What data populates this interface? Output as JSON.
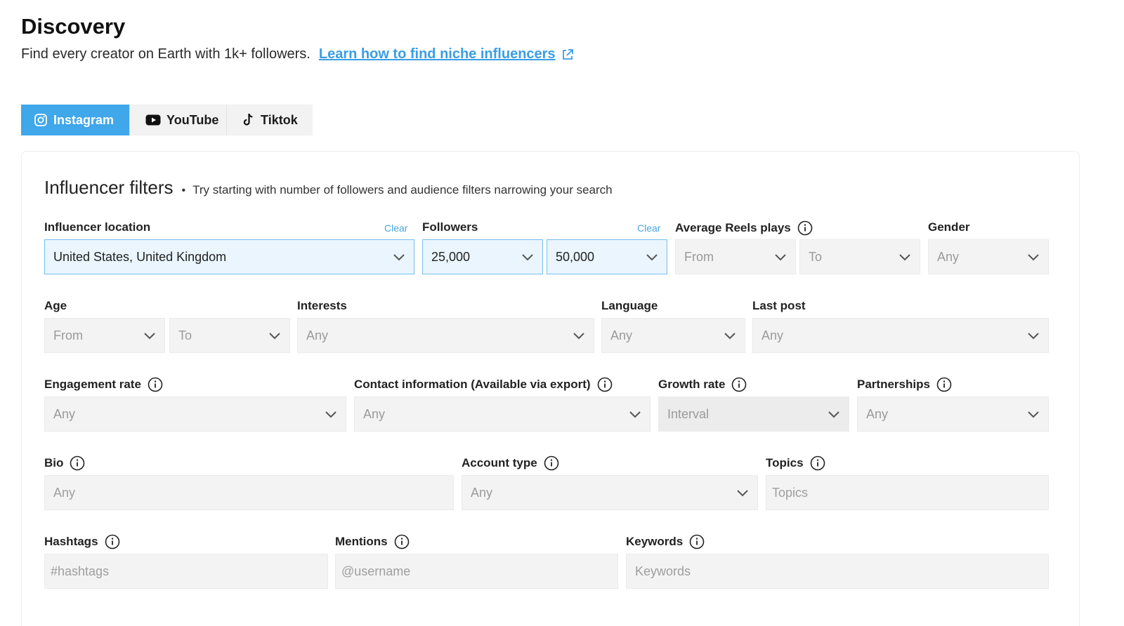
{
  "header": {
    "title": "Discovery",
    "subtitle": "Find every creator on Earth with 1k+ followers.",
    "link_label": "Learn how to find niche influencers"
  },
  "tabs": [
    {
      "label": "Instagram",
      "icon": "instagram-icon",
      "active": true
    },
    {
      "label": "YouTube",
      "icon": "youtube-icon",
      "active": false
    },
    {
      "label": "Tiktok",
      "icon": "tiktok-icon",
      "active": false
    }
  ],
  "filters": {
    "title": "Influencer filters",
    "hint": "Try starting with number of followers and audience filters narrowing your search",
    "clear_label": "Clear",
    "influencer_location": {
      "label": "Influencer location",
      "value": "United States, United Kingdom"
    },
    "followers": {
      "label": "Followers",
      "from": "25,000",
      "to": "50,000"
    },
    "avg_reels_plays": {
      "label": "Average Reels plays",
      "from": "From",
      "to": "To"
    },
    "gender": {
      "label": "Gender",
      "value": "Any"
    },
    "age": {
      "label": "Age",
      "from": "From",
      "to": "To"
    },
    "interests": {
      "label": "Interests",
      "value": "Any"
    },
    "language": {
      "label": "Language",
      "value": "Any"
    },
    "last_post": {
      "label": "Last post",
      "value": "Any"
    },
    "engagement_rate": {
      "label": "Engagement rate",
      "value": "Any"
    },
    "contact_info": {
      "label": "Contact information (Available via export)",
      "value": "Any"
    },
    "growth_rate": {
      "label": "Growth rate",
      "value": "Interval"
    },
    "partnerships": {
      "label": "Partnerships",
      "value": "Any"
    },
    "bio": {
      "label": "Bio",
      "placeholder": "Any"
    },
    "account_type": {
      "label": "Account type",
      "value": "Any"
    },
    "topics": {
      "label": "Topics",
      "placeholder": "Topics"
    },
    "hashtags": {
      "label": "Hashtags",
      "placeholder": "#hashtags"
    },
    "mentions": {
      "label": "Mentions",
      "placeholder": "@username"
    },
    "keywords": {
      "label": "Keywords",
      "placeholder": "Keywords"
    }
  },
  "colors": {
    "accent": "#3fa7ea",
    "link": "#3a9ee4",
    "selected_bg": "#eaf5fd"
  }
}
